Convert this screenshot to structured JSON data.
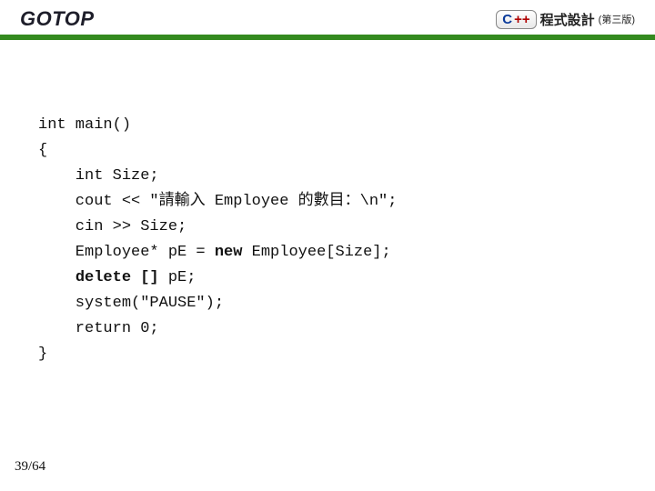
{
  "header": {
    "logo": "GOTOP",
    "badge_c": "C",
    "badge_plus": "++",
    "title": "程式設計",
    "edition": "(第三版)"
  },
  "code": {
    "l1": "int main()",
    "l2": "{",
    "l3": "    int Size;",
    "l4": "    cout << \"請輸入 Employee 的數目：\\n\";",
    "l5": "    cin >> Size;",
    "l6a": "    Employee* pE = ",
    "l6b": "new",
    "l6c": " Employee[Size];",
    "l7a": "    ",
    "l7b": "delete []",
    "l7c": " pE;",
    "l8": "    system(\"PAUSE\");",
    "l9": "    return 0;",
    "l10": "}"
  },
  "pagenum": "39/64"
}
